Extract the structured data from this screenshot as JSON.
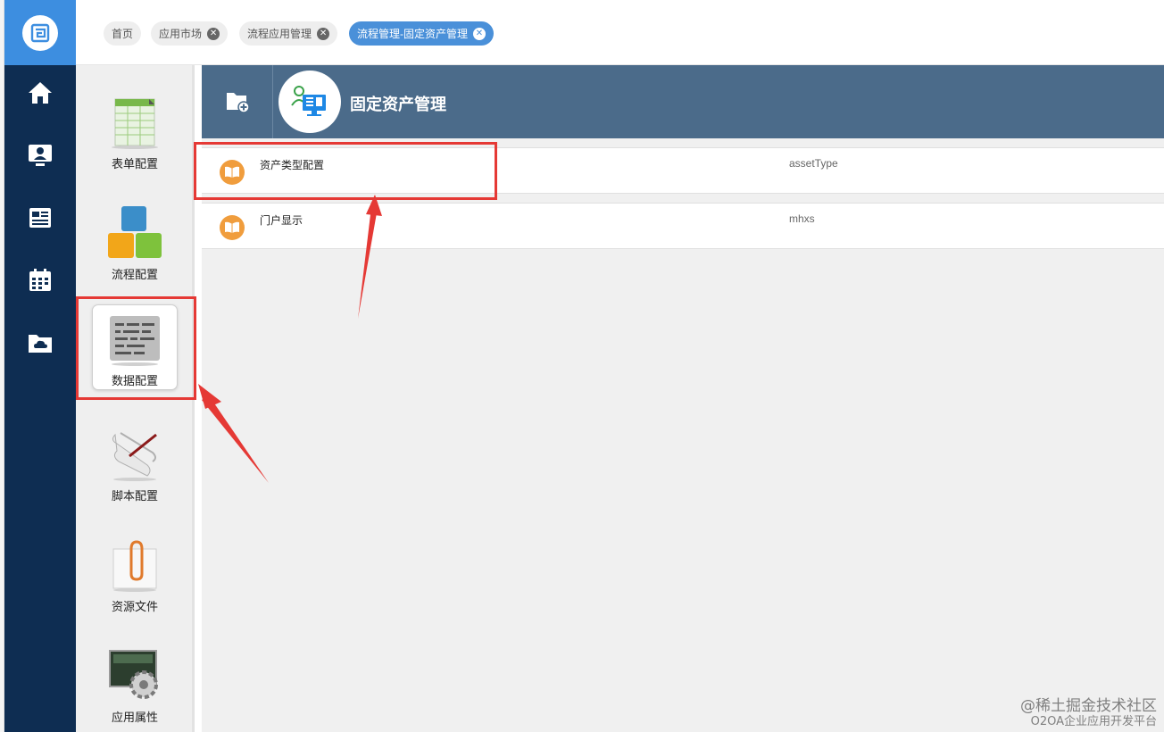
{
  "tabs": [
    {
      "label": "首页",
      "closable": false,
      "active": false
    },
    {
      "label": "应用市场",
      "closable": true,
      "active": false
    },
    {
      "label": "流程应用管理",
      "closable": true,
      "active": false
    },
    {
      "label": "流程管理-固定资产管理",
      "closable": true,
      "active": true
    }
  ],
  "left_nav": {
    "items": [
      {
        "icon": "home-icon"
      },
      {
        "icon": "user-screen-icon"
      },
      {
        "icon": "news-icon"
      },
      {
        "icon": "calendar-icon"
      },
      {
        "icon": "cloud-folder-icon"
      }
    ]
  },
  "sidebar": {
    "items": [
      {
        "label": "表单配置",
        "icon": "form-sheet-icon",
        "selected": false
      },
      {
        "label": "流程配置",
        "icon": "blocks-icon",
        "selected": false
      },
      {
        "label": "数据配置",
        "icon": "data-list-icon",
        "selected": true
      },
      {
        "label": "脚本配置",
        "icon": "script-scroll-icon",
        "selected": false
      },
      {
        "label": "资源文件",
        "icon": "paperclip-icon",
        "selected": false
      },
      {
        "label": "应用属性",
        "icon": "gear-icon",
        "selected": false
      }
    ]
  },
  "header": {
    "title": "固定资产管理",
    "add_icon": "add-folder-icon",
    "app_icon": "asset-monitor-icon"
  },
  "data_list": [
    {
      "name": "资产类型配置",
      "alias": "assetType",
      "icon": "book-icon"
    },
    {
      "name": "门户显示",
      "alias": "mhxs",
      "icon": "book-icon"
    }
  ],
  "watermark": {
    "line1": "@稀土掘金技术社区",
    "line2": "O2OA企业应用开发平台"
  },
  "colors": {
    "nav_bg": "#0e2d52",
    "accent": "#4a90d9",
    "header_bg": "#4b6b8a",
    "annotation": "#e53935",
    "list_icon": "#f09d3d"
  }
}
